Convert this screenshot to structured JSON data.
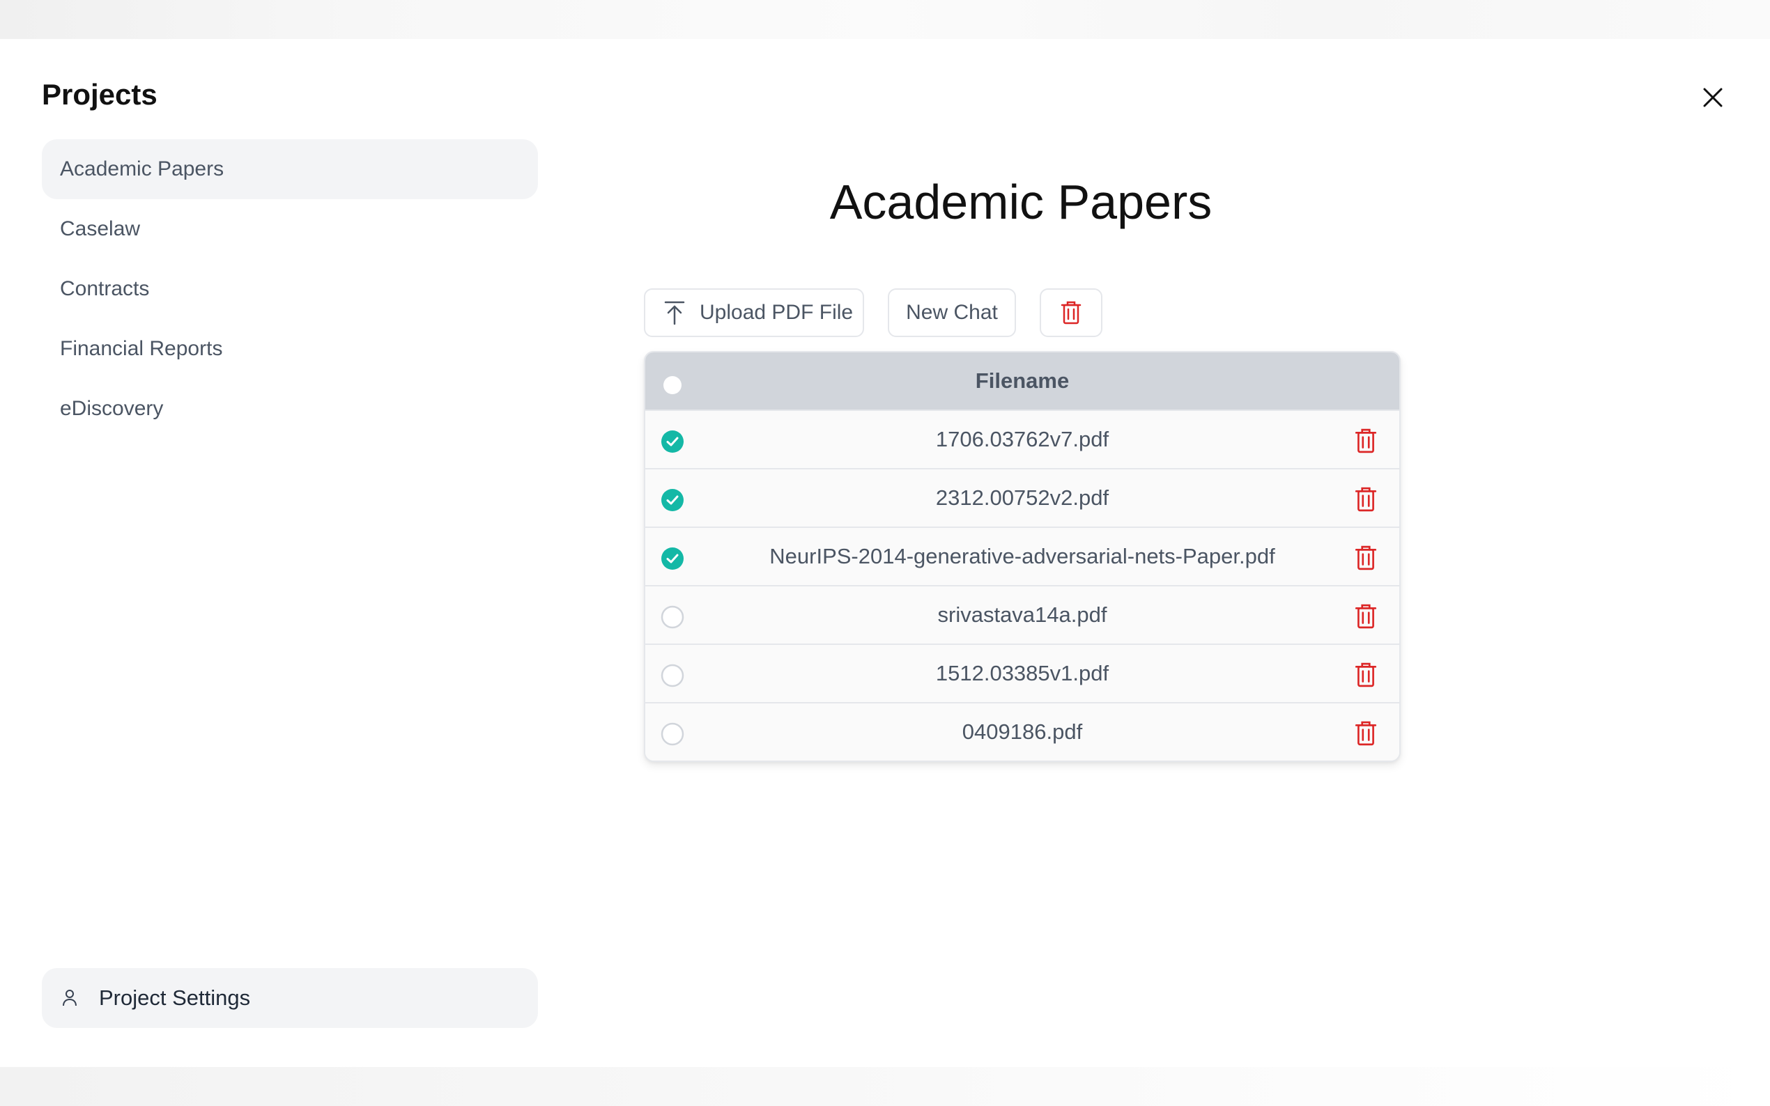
{
  "sidebar": {
    "title": "Projects",
    "items": [
      {
        "label": "Academic Papers",
        "active": true
      },
      {
        "label": "Caselaw"
      },
      {
        "label": "Contracts"
      },
      {
        "label": "Financial Reports"
      },
      {
        "label": "eDiscovery"
      }
    ],
    "settings_label": "Project Settings"
  },
  "main": {
    "title": "Academic Papers",
    "toolbar": {
      "upload_label": "Upload PDF File",
      "new_chat_label": "New Chat"
    },
    "table": {
      "header": "Filename",
      "rows": [
        {
          "filename": "1706.03762v7.pdf",
          "checked": true
        },
        {
          "filename": "2312.00752v2.pdf",
          "checked": true
        },
        {
          "filename": "NeurIPS-2014-generative-adversarial-nets-Paper.pdf",
          "checked": true
        },
        {
          "filename": "srivastava14a.pdf",
          "checked": false
        },
        {
          "filename": "1512.03385v1.pdf",
          "checked": false
        },
        {
          "filename": "0409186.pdf",
          "checked": false
        }
      ]
    }
  },
  "colors": {
    "accent": "#14b8a6",
    "danger": "#dc2626",
    "header_bg": "#d1d5db"
  }
}
